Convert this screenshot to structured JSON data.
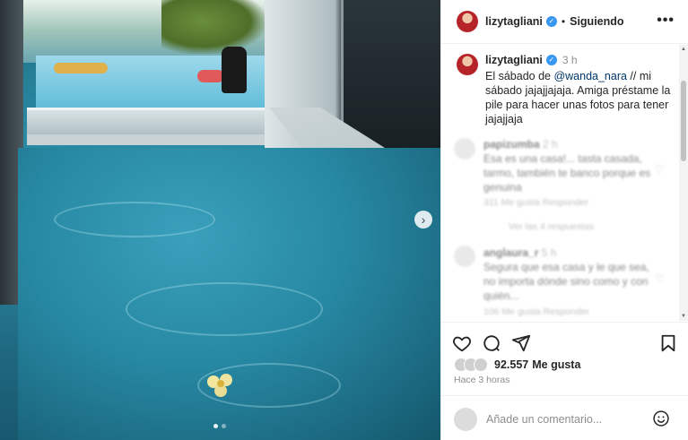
{
  "post": {
    "username": "lizytagliani",
    "follow_status": "Siguiendo",
    "separator": "•",
    "more_label": "•••"
  },
  "caption": {
    "username": "lizytagliani",
    "time": "3 h",
    "text_before": "El sábado de ",
    "mention": "@wanda_nara",
    "text_after": " // mi sábado jajajjajaja. Amiga préstame la pile para hacer unas fotos para tener jajajjaja"
  },
  "comments": [
    {
      "username": "papizumba",
      "time": "2 h",
      "text": "Esa es una casa!... tasta casada, tarmo, también te banco porque es genuina",
      "meta": "311 Me gusta  Responder",
      "replies": "Ver las 4 respuestas"
    },
    {
      "username": "anglaura_r",
      "time": "5 h",
      "text": "Segura que esa casa y le que sea, no importa dónde sino como y con quién...",
      "meta": "106 Me gusta  Responder"
    }
  ],
  "likes": {
    "count": "92.557",
    "label": "Me gusta"
  },
  "timestamp": "Hace 3 horas",
  "comment_box": {
    "placeholder": "Añade un comentario..."
  },
  "carousel": {
    "next_label": "›"
  },
  "icons": [
    "heart-icon",
    "comment-icon",
    "share-icon",
    "bookmark-icon",
    "emoji-icon",
    "verified-icon",
    "more-icon"
  ],
  "colors": {
    "link": "#00376b",
    "verified": "#3897f0",
    "muted": "#8e8e8e"
  }
}
